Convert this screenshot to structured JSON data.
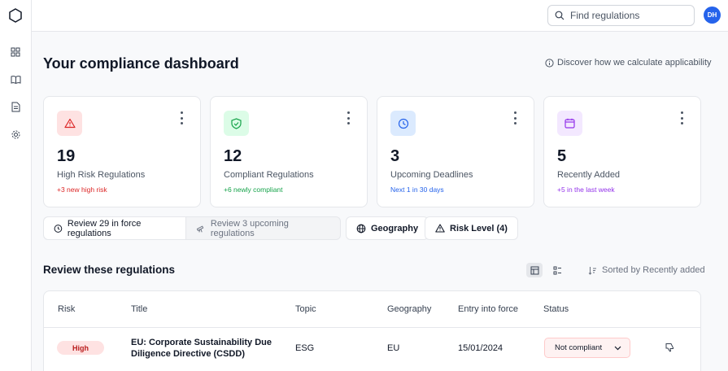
{
  "topbar": {
    "search_placeholder": "Find regulations",
    "avatar_initials": "DH"
  },
  "page": {
    "title": "Your compliance dashboard",
    "discover_link": "Discover how we calculate applicability"
  },
  "cards": [
    {
      "value": "19",
      "label": "High Risk Regulations",
      "sub": "+3 new high risk",
      "icon": "warning-icon",
      "accent": "#dc2626",
      "icon_bg": "#fee2e2"
    },
    {
      "value": "12",
      "label": "Compliant Regulations",
      "sub": "+6 newly compliant",
      "icon": "shield-check-icon",
      "accent": "#16a34a",
      "icon_bg": "#dcfce7"
    },
    {
      "value": "3",
      "label": "Upcoming Deadlines",
      "sub": "Next 1 in 30 days",
      "icon": "clock-icon",
      "accent": "#2563eb",
      "icon_bg": "#dbeafe"
    },
    {
      "value": "5",
      "label": "Recently Added",
      "sub": "+5 in the last week",
      "icon": "calendar-icon",
      "accent": "#9333ea",
      "icon_bg": "#f3e8ff"
    }
  ],
  "filters": {
    "in_force": "Review 29 in force regulations",
    "upcoming": "Review 3 upcoming regulations",
    "geography": "Geography",
    "risk_level": "Risk Level (4)"
  },
  "section": {
    "title": "Review these regulations",
    "sort_label": "Sorted by Recently added"
  },
  "table": {
    "headers": [
      "Risk",
      "Title",
      "Topic",
      "Geography",
      "Entry into force",
      "Status"
    ],
    "rows": [
      {
        "risk": "High",
        "title_line1": "EU: Corporate Sustainability Due",
        "title_line2": "Diligence Directive (CSDD)",
        "topic": "ESG",
        "geography": "EU",
        "entry": "15/01/2024",
        "status": "Not compliant"
      }
    ]
  }
}
